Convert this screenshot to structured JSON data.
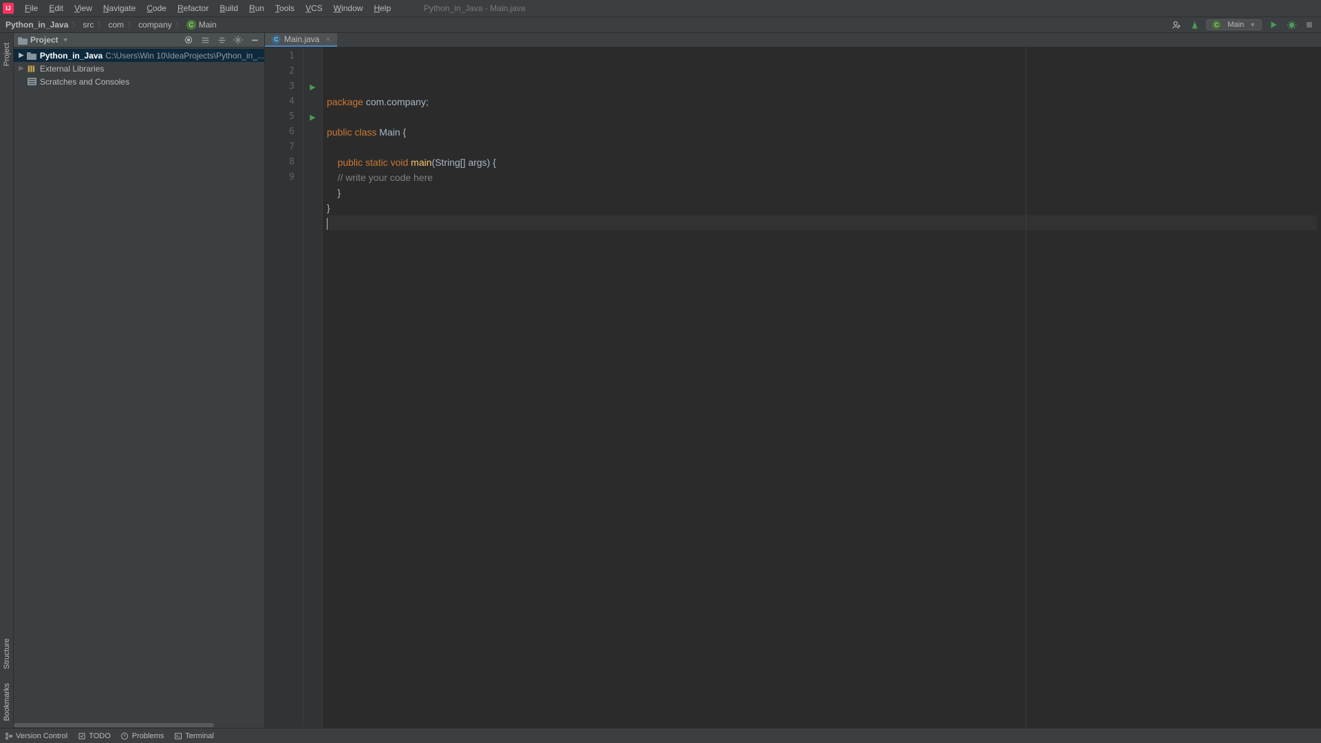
{
  "titleBar": {
    "menus": [
      "File",
      "Edit",
      "View",
      "Navigate",
      "Code",
      "Refactor",
      "Build",
      "Run",
      "Tools",
      "VCS",
      "Window",
      "Help"
    ],
    "title": "Python_in_Java - Main.java"
  },
  "breadcrumbs": {
    "parts": [
      "Python_in_Java",
      "src",
      "com",
      "company"
    ],
    "clazz": "Main"
  },
  "runConfig": {
    "name": "Main"
  },
  "projectPanel": {
    "title": "Project",
    "root": {
      "name": "Python_in_Java",
      "path": "C:\\Users\\Win 10\\IdeaProjects\\Python_in_..."
    },
    "externalLibs": "External Libraries",
    "scratches": "Scratches and Consoles"
  },
  "tab": {
    "name": "Main.java"
  },
  "code": {
    "lines": [
      {
        "n": 1,
        "run": false,
        "fold": "",
        "tokens": [
          [
            "kw",
            "package"
          ],
          [
            "pln",
            " com.company"
          ],
          [
            "pln",
            ";"
          ]
        ]
      },
      {
        "n": 2,
        "run": false,
        "fold": "",
        "tokens": []
      },
      {
        "n": 3,
        "run": true,
        "fold": "open",
        "tokens": [
          [
            "kw",
            "public class"
          ],
          [
            "pln",
            " "
          ],
          [
            "cls",
            "Main"
          ],
          [
            "pln",
            " {"
          ]
        ]
      },
      {
        "n": 4,
        "run": false,
        "fold": "",
        "tokens": []
      },
      {
        "n": 5,
        "run": true,
        "fold": "open",
        "tokens": [
          [
            "pln",
            "    "
          ],
          [
            "kw",
            "public static void"
          ],
          [
            "pln",
            " "
          ],
          [
            "meth",
            "main"
          ],
          [
            "pln",
            "("
          ],
          [
            "str-type",
            "String"
          ],
          [
            "pln",
            "[] args) {"
          ]
        ]
      },
      {
        "n": 6,
        "run": false,
        "fold": "",
        "tokens": [
          [
            "pln",
            "    "
          ],
          [
            "cmt",
            "// write your code here"
          ]
        ]
      },
      {
        "n": 7,
        "run": false,
        "fold": "close",
        "tokens": [
          [
            "pln",
            "    }"
          ]
        ]
      },
      {
        "n": 8,
        "run": false,
        "fold": "close",
        "tokens": [
          [
            "pln",
            "}"
          ]
        ]
      },
      {
        "n": 9,
        "run": false,
        "fold": "",
        "tokens": [],
        "current": true
      }
    ]
  },
  "leftRail": {
    "project": "Project"
  },
  "leftRailBottom": {
    "structure": "Structure",
    "bookmarks": "Bookmarks"
  },
  "bottomBar": {
    "items": [
      "Version Control",
      "TODO",
      "Problems",
      "Terminal"
    ]
  }
}
